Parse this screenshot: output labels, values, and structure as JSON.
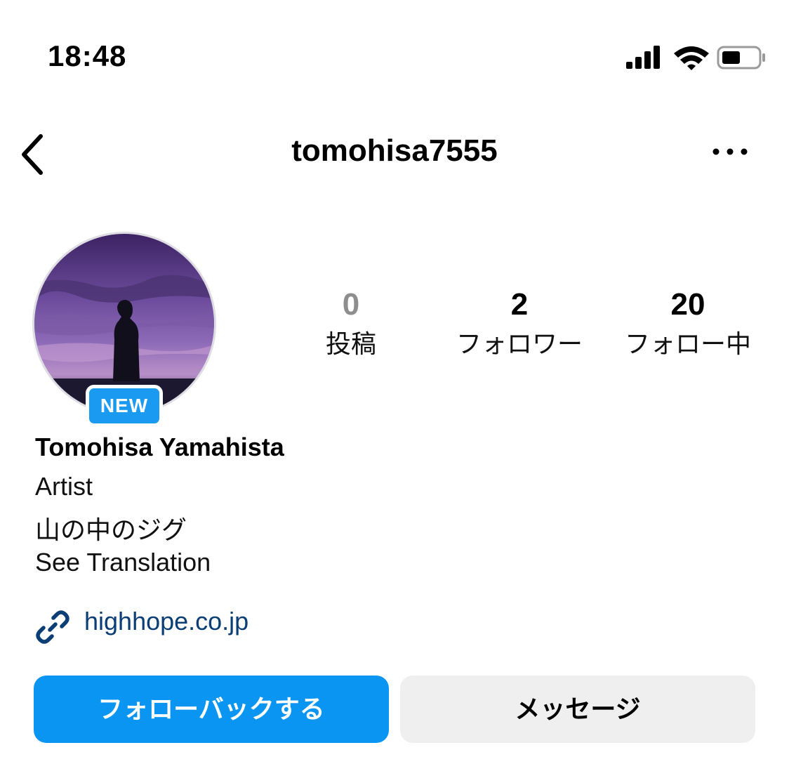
{
  "status_bar": {
    "time": "18:48",
    "icons": [
      "cellular-signal-icon",
      "wifi-icon",
      "battery-icon"
    ],
    "battery_level": 0.5
  },
  "nav": {
    "username": "tomohisa7555",
    "back_icon": "chevron-left-icon",
    "more_icon": "more-horizontal-icon"
  },
  "profile": {
    "badge": "NEW",
    "name": "Tomohisa Yamahista",
    "category": "Artist",
    "bio": "山の中のジグ",
    "see_translation": "See Translation",
    "link": "highhope.co.jp",
    "link_icon": "link-icon"
  },
  "stats": {
    "posts": {
      "value": "0",
      "label": "投稿"
    },
    "followers": {
      "value": "2",
      "label": "フォロワー"
    },
    "following": {
      "value": "20",
      "label": "フォロー中"
    }
  },
  "actions": {
    "follow_back": "フォローバックする",
    "message": "メッセージ"
  },
  "colors": {
    "accent": "#0b95f2",
    "badge": "#1a9af0",
    "link": "#0b3e75",
    "secondary_button": "#efefef",
    "muted_count": "#8e8e8e"
  }
}
